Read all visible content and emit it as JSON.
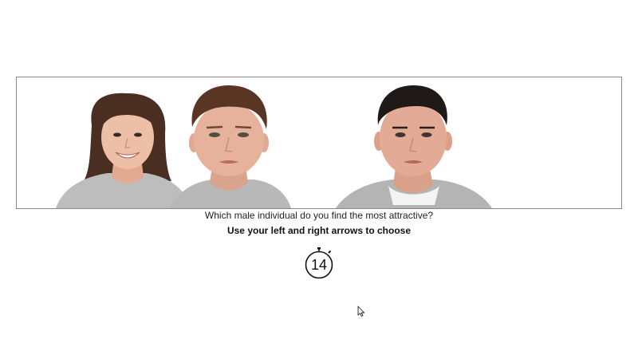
{
  "trial": {
    "question": "Which male individual do you find the most attractive?",
    "instruction": "Use your left and right arrows to choose",
    "timer_value": "14",
    "faces": [
      {
        "description_icon": "female-face-smiling-photo",
        "role": "left-distractor"
      },
      {
        "description_icon": "male-face-brown-hair-photo",
        "role": "left-choice"
      },
      {
        "description_icon": "male-face-dark-hair-photo",
        "role": "right-choice"
      }
    ]
  },
  "colors": {
    "frame_border": "#8a8a8a",
    "text": "#222222",
    "shirt_gray": "#b9b9b9",
    "skin": "#e7b8a0"
  },
  "icons": {
    "timer": "stopwatch-icon",
    "cursor": "mouse-pointer-icon"
  }
}
